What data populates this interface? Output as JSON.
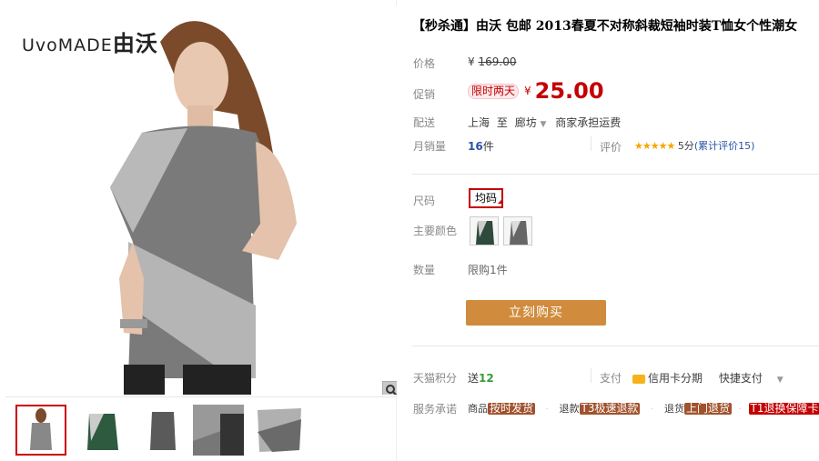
{
  "logo": {
    "brand_text": "UvoMADE",
    "brand_cn": "由沃"
  },
  "title": "【秒杀通】由沃 包邮 2013春夏不对称斜裁短袖时装T恤女个性潮女",
  "price": {
    "label": "价格",
    "original_prefix": "¥",
    "original_value": "169.00"
  },
  "promo": {
    "label": "促销",
    "tag": "限时两天",
    "currency": "¥",
    "value": "25.00"
  },
  "shipping": {
    "label": "配送",
    "from": "上海",
    "to_word": "至",
    "dest": "廊坊",
    "fee": "商家承担运费"
  },
  "monthly_sales": {
    "label": "月销量",
    "count": "16",
    "unit": "件"
  },
  "rating": {
    "label": "评价",
    "stars": "★★★★★",
    "score": "5分",
    "count_text": "(累计评价15)"
  },
  "size": {
    "label": "尺码",
    "option": "均码"
  },
  "color": {
    "label": "主要颜色"
  },
  "quantity": {
    "label": "数量",
    "limit": "限购1件"
  },
  "buy_button": "立刻购买",
  "points": {
    "label": "天猫积分",
    "prefix": "送",
    "value": "12"
  },
  "payment": {
    "label": "支付",
    "credit": "信用卡分期",
    "quick": "快捷支付"
  },
  "service": {
    "label": "服务承诺",
    "goods_prefix": "商品",
    "goods_badge": "按时发货",
    "refund_prefix": "退款",
    "refund_badge": "T3极速退款",
    "return_prefix": "退货",
    "return_badge": "上门退货",
    "exchange_badge": "T1退换保障卡"
  },
  "colors": {
    "accent": "#c40000",
    "buy": "#d08b3c"
  }
}
